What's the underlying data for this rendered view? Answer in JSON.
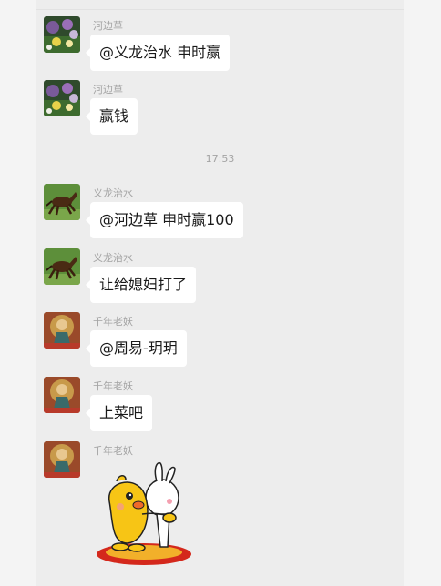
{
  "timestamp": "17:53",
  "messages": [
    {
      "sender": "河边草",
      "text": "@义龙治水  申时赢",
      "avatar_icon": "flower-avatar-icon"
    },
    {
      "sender": "河边草",
      "text": "赢钱",
      "avatar_icon": "flower-avatar-icon"
    },
    {
      "sender": "义龙治水",
      "text": "@河边草  申时赢100",
      "avatar_icon": "horse-avatar-icon"
    },
    {
      "sender": "义龙治水",
      "text": "让给媳妇打了",
      "avatar_icon": "horse-avatar-icon"
    },
    {
      "sender": "千年老妖",
      "text": "@周易-玥玥",
      "avatar_icon": "deity-avatar-icon"
    },
    {
      "sender": "千年老妖",
      "text": "上菜吧",
      "avatar_icon": "deity-avatar-icon"
    },
    {
      "sender": "千年老妖",
      "sticker": "hugging-cartoon-sticker",
      "avatar_icon": "deity-avatar-icon"
    }
  ],
  "colors": {
    "chat_background": "#ededed",
    "bubble": "#ffffff",
    "sender_text": "#a3a3a3",
    "message_text": "#191919"
  }
}
